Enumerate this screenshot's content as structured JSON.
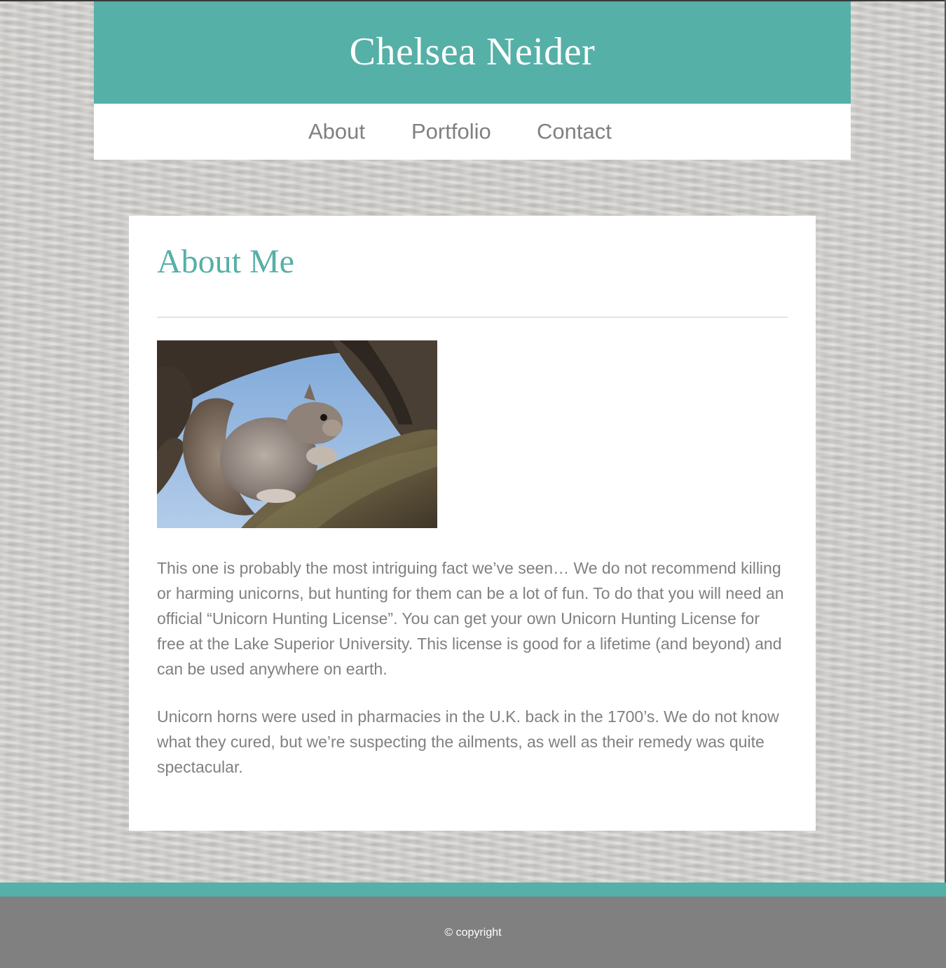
{
  "header": {
    "site_title": "Chelsea Neider"
  },
  "nav": {
    "items": [
      {
        "label": "About"
      },
      {
        "label": "Portfolio"
      },
      {
        "label": "Contact"
      }
    ]
  },
  "main": {
    "heading": "About Me",
    "image": {
      "subject": "gray squirrel sitting on a tree branch"
    },
    "paragraphs": [
      "This one is probably the most intriguing fact we’ve seen… We do not recommend killing or harming unicorns, but hunting for them can be a lot of fun. To do that you will need an official “Unicorn Hunting License”. You can get your own Unicorn Hunting License for free at the Lake Superior University. This license is good for a lifetime (and beyond) and can be used anywhere on earth.",
      "Unicorn horns were used in pharmacies in the U.K. back in the 1700’s. We do not know what they cured, but we’re suspecting the ailments, as well as their remedy was quite spectacular."
    ]
  },
  "footer": {
    "copyright": "© copyright"
  },
  "colors": {
    "accent": "#55b0a7",
    "text": "#808080",
    "footer": "#808080",
    "background": "#cfcdca"
  }
}
